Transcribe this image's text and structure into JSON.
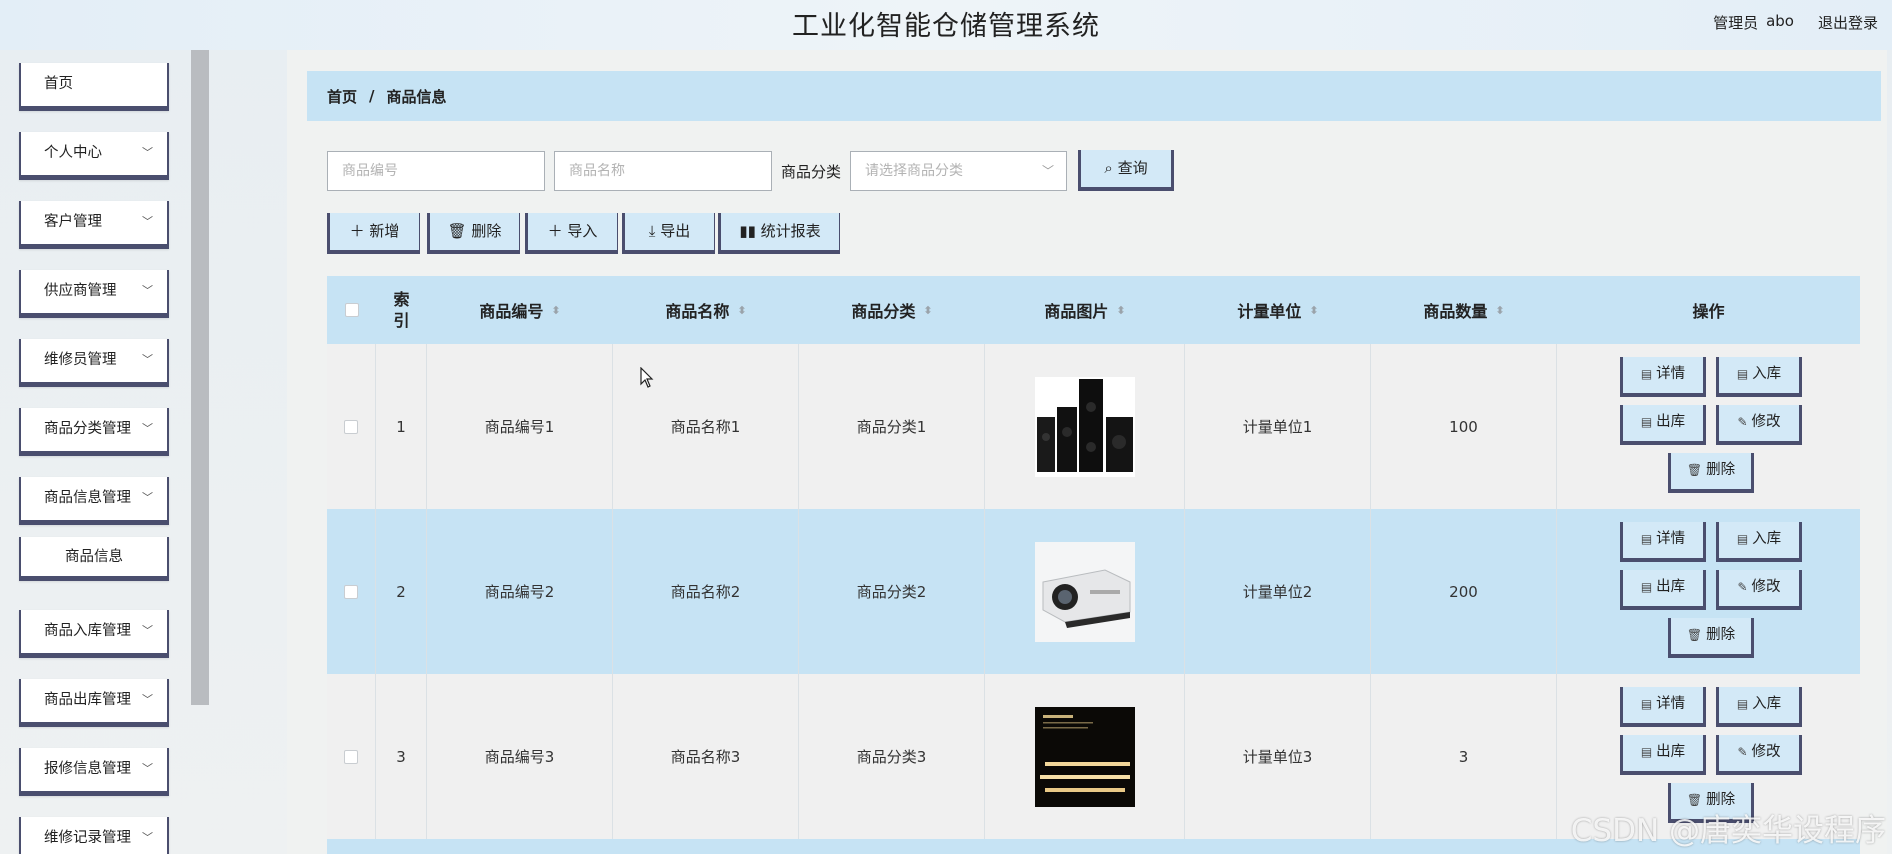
{
  "header": {
    "title": "工业化智能仓储管理系统",
    "user_role": "管理员",
    "user_name": "abo",
    "logout": "退出登录"
  },
  "sidebar": {
    "items": [
      {
        "label": "首页",
        "has_chevron": false
      },
      {
        "label": "个人中心",
        "has_chevron": true
      },
      {
        "label": "客户管理",
        "has_chevron": true
      },
      {
        "label": "供应商管理",
        "has_chevron": true
      },
      {
        "label": "维修员管理",
        "has_chevron": true
      },
      {
        "label": "商品分类管理",
        "has_chevron": true
      },
      {
        "label": "商品信息管理",
        "has_chevron": true
      },
      {
        "label": "商品信息",
        "has_chevron": false
      },
      {
        "label": "商品入库管理",
        "has_chevron": true
      },
      {
        "label": "商品出库管理",
        "has_chevron": true
      },
      {
        "label": "报修信息管理",
        "has_chevron": true
      },
      {
        "label": "维修记录管理",
        "has_chevron": true
      }
    ]
  },
  "breadcrumb": {
    "home": "首页",
    "separator": "/",
    "current": "商品信息"
  },
  "search": {
    "code_placeholder": "商品编号",
    "name_placeholder": "商品名称",
    "category_label": "商品分类",
    "category_placeholder": "请选择商品分类",
    "query_label": "查询"
  },
  "toolbar": {
    "add": "新增",
    "delete": "删除",
    "import": "导入",
    "export": "导出",
    "report": "统计报表"
  },
  "table": {
    "headers": [
      "索引",
      "商品编号",
      "商品名称",
      "商品分类",
      "商品图片",
      "计量单位",
      "商品数量",
      "操作"
    ],
    "rows": [
      {
        "index": "1",
        "code": "商品编号1",
        "name": "商品名称1",
        "category": "商品分类1",
        "image": "speakers",
        "unit": "计量单位1",
        "qty": "100"
      },
      {
        "index": "2",
        "code": "商品编号2",
        "name": "商品名称2",
        "category": "商品分类2",
        "image": "projector",
        "unit": "计量单位2",
        "qty": "200"
      },
      {
        "index": "3",
        "code": "商品编号3",
        "name": "商品名称3",
        "category": "商品分类3",
        "image": "light-bars",
        "unit": "计量单位3",
        "qty": "3"
      }
    ],
    "actions": {
      "detail": "详情",
      "stock_in": "入库",
      "stock_out": "出库",
      "edit": "修改",
      "delete": "删除"
    }
  },
  "watermark": "CSDN @唐奕华设程序",
  "colors": {
    "accent_bg": "#c6e3f4",
    "button_border": "#4a4e6e",
    "button_bg": "#d3e9f7"
  }
}
